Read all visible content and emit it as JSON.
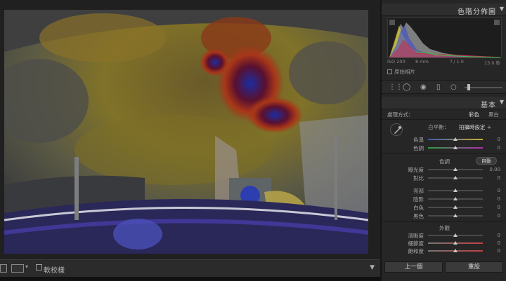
{
  "histogram": {
    "title": "色階分佈圖",
    "iso": "ISO 200",
    "focal": "8 mm",
    "aperture": "f / 1.0",
    "shutter": "13.0 秒",
    "original_label": "原始相片"
  },
  "basic": {
    "title": "基本",
    "treatment_label": "處理方式：",
    "treatment_color": "彩色",
    "treatment_bw": "黑白",
    "wb_label": "白平衡：",
    "wb_value": "拍攝時設定 ÷",
    "temp_label": "色溫",
    "temp_value": "0",
    "tint_label": "色調",
    "tint_value": "0",
    "tone_label": "色調",
    "auto_label": "自動",
    "exposure_label": "曝光度",
    "exposure_value": "0.00",
    "contrast_label": "對比",
    "contrast_value": "0",
    "highlights_label": "亮部",
    "highlights_value": "0",
    "shadows_label": "陰影",
    "shadows_value": "0",
    "whites_label": "白色",
    "whites_value": "0",
    "blacks_label": "黑色",
    "blacks_value": "0",
    "presence_label": "外觀",
    "clarity_label": "清晰度",
    "clarity_value": "0",
    "vibrance_label": "細節度",
    "vibrance_value": "0",
    "saturation_label": "飽和度",
    "saturation_value": "0"
  },
  "filmstrip": {
    "proof_label": "軟校樣"
  },
  "buttons": {
    "previous": "上一個",
    "reset": "重設"
  },
  "colors": {
    "panel_bg": "#262626",
    "accent": "#c8c8c8"
  }
}
